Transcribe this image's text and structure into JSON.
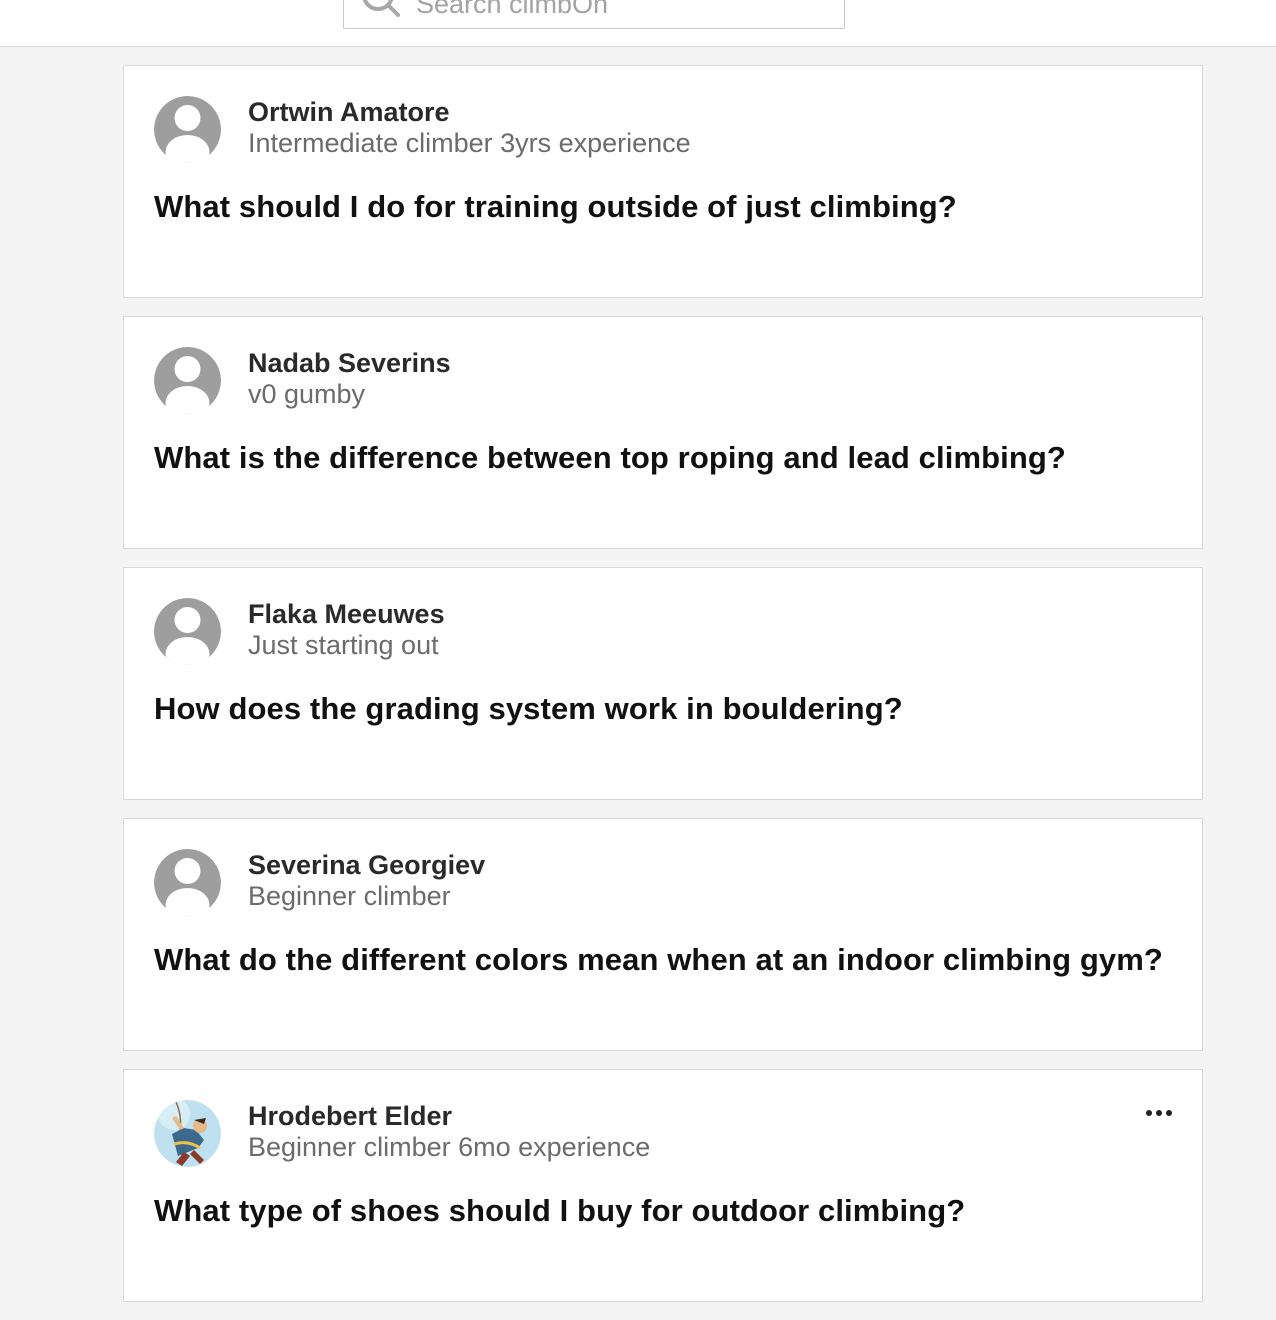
{
  "search": {
    "placeholder": "Search climbOn"
  },
  "posts": [
    {
      "author": "Ortwin Amatore",
      "tagline": "Intermediate climber 3yrs experience",
      "question": "What should I do for training outside of just climbing?",
      "avatar": "default-avatar-icon"
    },
    {
      "author": "Nadab Severins",
      "tagline": "v0 gumby",
      "question": "What is the difference between top roping and lead climbing?",
      "avatar": "default-avatar-icon"
    },
    {
      "author": "Flaka Meeuwes",
      "tagline": "Just starting out",
      "question": "How does the grading system work in bouldering?",
      "avatar": "default-avatar-icon"
    },
    {
      "author": "Severina Georgiev",
      "tagline": "Beginner climber",
      "question": "What do the different colors mean when at an indoor climbing gym?",
      "avatar": "default-avatar-icon"
    },
    {
      "author": "Hrodebert Elder",
      "tagline": "Beginner climber 6mo experience",
      "question": "What type of shoes should I buy for outdoor climbing?",
      "avatar": "climber-photo-avatar",
      "has_menu": true,
      "menu_icon": "more-options-icon"
    }
  ],
  "colors": {
    "page_background": "#f4f4f4",
    "card_border": "#d8d8d8",
    "avatar_gray": "#9e9e9e"
  }
}
